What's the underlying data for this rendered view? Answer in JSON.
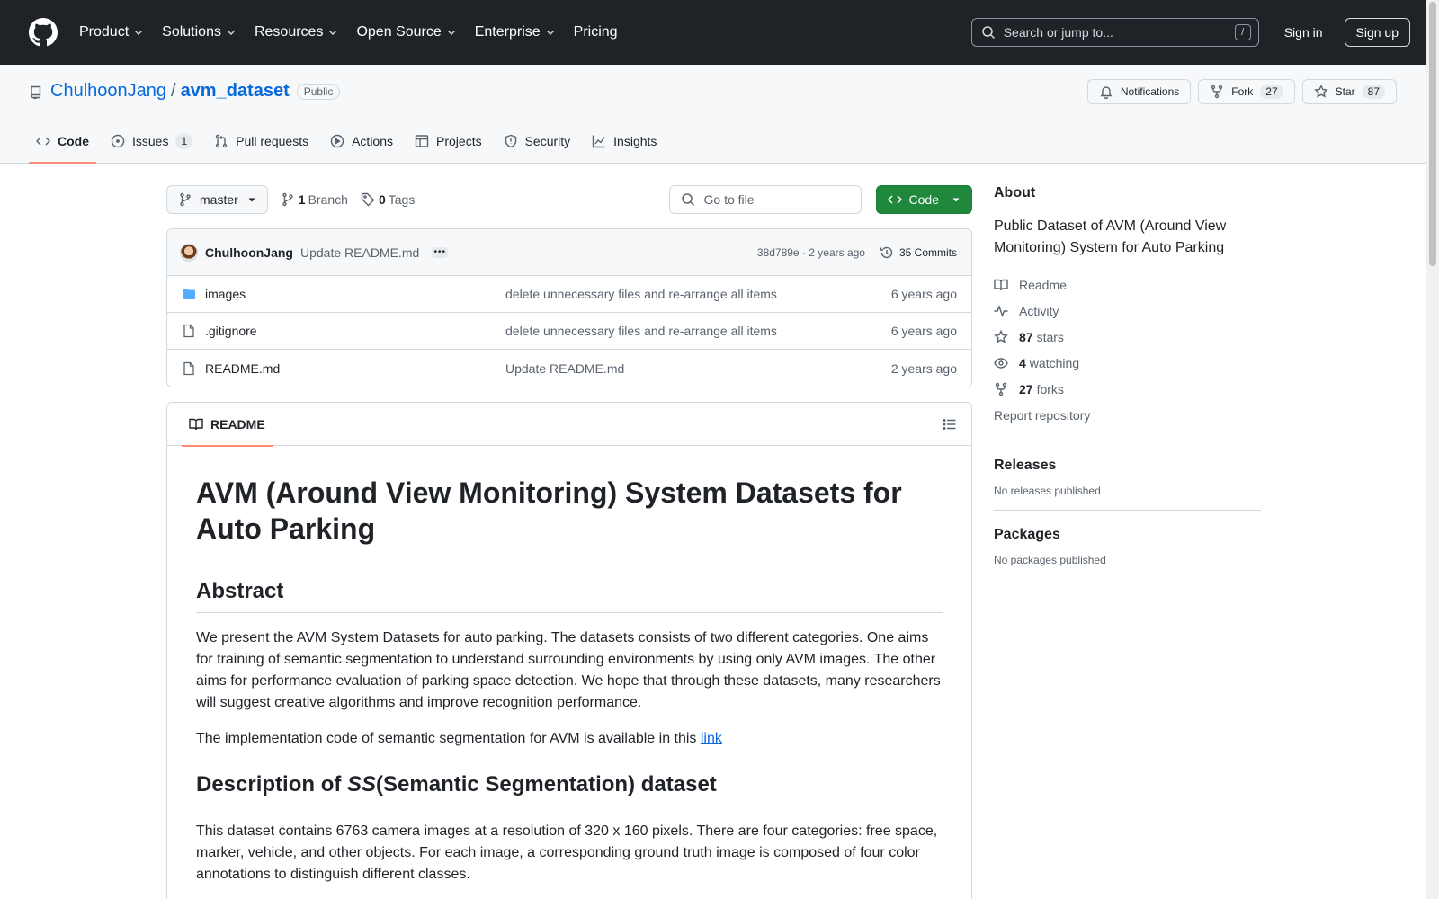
{
  "header": {
    "nav": [
      {
        "label": "Product",
        "has_menu": true
      },
      {
        "label": "Solutions",
        "has_menu": true
      },
      {
        "label": "Resources",
        "has_menu": true
      },
      {
        "label": "Open Source",
        "has_menu": true
      },
      {
        "label": "Enterprise",
        "has_menu": true
      },
      {
        "label": "Pricing",
        "has_menu": false
      }
    ],
    "search_placeholder": "Search or jump to...",
    "search_shortcut": "/",
    "sign_in": "Sign in",
    "sign_up": "Sign up"
  },
  "repo": {
    "owner": "ChulhoonJang",
    "separator": "/",
    "name": "avm_dataset",
    "visibility": "Public",
    "notifications_label": "Notifications",
    "fork_label": "Fork",
    "fork_count": "27",
    "star_label": "Star",
    "star_count": "87",
    "tabs": [
      {
        "label": "Code",
        "icon": "code-icon",
        "active": true,
        "count": ""
      },
      {
        "label": "Issues",
        "icon": "issue-icon",
        "active": false,
        "count": "1"
      },
      {
        "label": "Pull requests",
        "icon": "pull-request-icon",
        "active": false,
        "count": ""
      },
      {
        "label": "Actions",
        "icon": "play-icon",
        "active": false,
        "count": ""
      },
      {
        "label": "Projects",
        "icon": "table-icon",
        "active": false,
        "count": ""
      },
      {
        "label": "Security",
        "icon": "shield-icon",
        "active": false,
        "count": ""
      },
      {
        "label": "Insights",
        "icon": "graph-icon",
        "active": false,
        "count": ""
      }
    ]
  },
  "toolbar": {
    "branch": "master",
    "branch_count": "1",
    "branch_label": "Branch",
    "tag_count": "0",
    "tag_label": "Tags",
    "goto_placeholder": "Go to file",
    "code_label": "Code"
  },
  "commit": {
    "author": "ChulhoonJang",
    "message": "Update README.md",
    "meta": "38d789e · 2 years ago",
    "commits_label": "35 Commits"
  },
  "files": [
    {
      "type": "folder",
      "name": "images",
      "message": "delete unnecessary files and re-arrange all items",
      "time": "6 years ago"
    },
    {
      "type": "file",
      "name": ".gitignore",
      "message": "delete unnecessary files and re-arrange all items",
      "time": "6 years ago"
    },
    {
      "type": "file",
      "name": "README.md",
      "message": "Update README.md",
      "time": "2 years ago"
    }
  ],
  "readme": {
    "tab_label": "README",
    "h1": "AVM (Around View Monitoring) System Datasets for Auto Parking",
    "h2_abstract": "Abstract",
    "p1": "We present the AVM System Datasets for auto parking. The datasets consists of two different categories. One aims for training of semantic segmentation to understand surrounding environments by using only AVM images. The other aims for performance evaluation of parking space detection. We hope that through these datasets, many researchers will suggest creative algorithms and improve recognition performance.",
    "p2_text": "The implementation code of semantic segmentation for AVM is available in this ",
    "p2_link": "link",
    "h2_desc_prefix": "Description of ",
    "h2_desc_em": "SS",
    "h2_desc_suffix": "(Semantic Segmentation) dataset",
    "p3": "This dataset contains 6763 camera images at a resolution of 320 x 160 pixels. There are four categories: free space, marker, vehicle, and other objects. For each image, a corresponding ground truth image is composed of four color annotations to distinguish different classes."
  },
  "sidebar": {
    "about_title": "About",
    "about_text": "Public Dataset of AVM (Around View Monitoring) System for Auto Parking",
    "readme": "Readme",
    "activity": "Activity",
    "stars_count": "87",
    "stars_label": "stars",
    "watching_count": "4",
    "watching_label": "watching",
    "forks_count": "27",
    "forks_label": "forks",
    "report": "Report repository",
    "releases_title": "Releases",
    "releases_text": "No releases published",
    "packages_title": "Packages",
    "packages_text": "No packages published"
  },
  "colors": {
    "header_bg": "#1f2328",
    "link": "#0969da",
    "code_button": "#1f883d",
    "active_tab_underline": "#fd8c73",
    "folder_icon": "#54aeff"
  }
}
